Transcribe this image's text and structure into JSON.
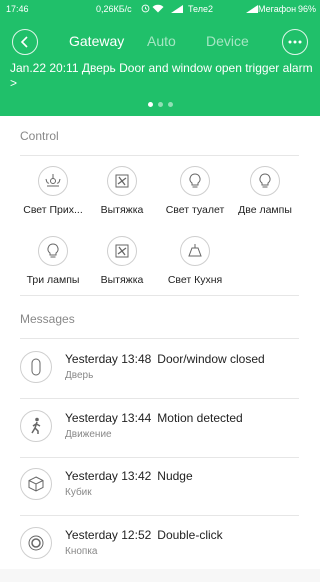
{
  "status_bar": {
    "time": "17:46",
    "network_speed": "0,26КБ/с",
    "carrier1": "Теле2",
    "carrier2": "Мегафон",
    "battery": "96%"
  },
  "header": {
    "tabs": [
      {
        "label": "Gateway",
        "active": true
      },
      {
        "label": "Auto",
        "active": false
      },
      {
        "label": "Device",
        "active": false
      }
    ],
    "alarm_text": "Jan.22 20:11  Дверь Door and window open trigger alarm >",
    "page_dots": 3,
    "active_dot": 0,
    "accent_color": "#20c06a"
  },
  "control": {
    "title": "Control",
    "devices": [
      {
        "label": "Свет Прих...",
        "icon": "ceiling-light-icon"
      },
      {
        "label": "Вытяжка",
        "icon": "fan-icon"
      },
      {
        "label": "Свет туалет",
        "icon": "bulb-icon"
      },
      {
        "label": "Две лампы",
        "icon": "bulb-icon"
      },
      {
        "label": "Три лампы",
        "icon": "bulb-icon"
      },
      {
        "label": "Вытяжка",
        "icon": "fan-icon"
      },
      {
        "label": "Свет Кухня",
        "icon": "pendant-lamp-icon"
      }
    ]
  },
  "messages": {
    "title": "Messages",
    "items": [
      {
        "time": "Yesterday 13:48",
        "event": "Door/window closed",
        "device": "Дверь",
        "icon": "door-sensor-icon"
      },
      {
        "time": "Yesterday 13:44",
        "event": "Motion detected",
        "device": "Движение",
        "icon": "walking-person-icon"
      },
      {
        "time": "Yesterday 13:42",
        "event": "Nudge",
        "device": "Кубик",
        "icon": "cube-icon"
      },
      {
        "time": "Yesterday 12:52",
        "event": "Double-click",
        "device": "Кнопка",
        "icon": "button-icon"
      }
    ]
  }
}
